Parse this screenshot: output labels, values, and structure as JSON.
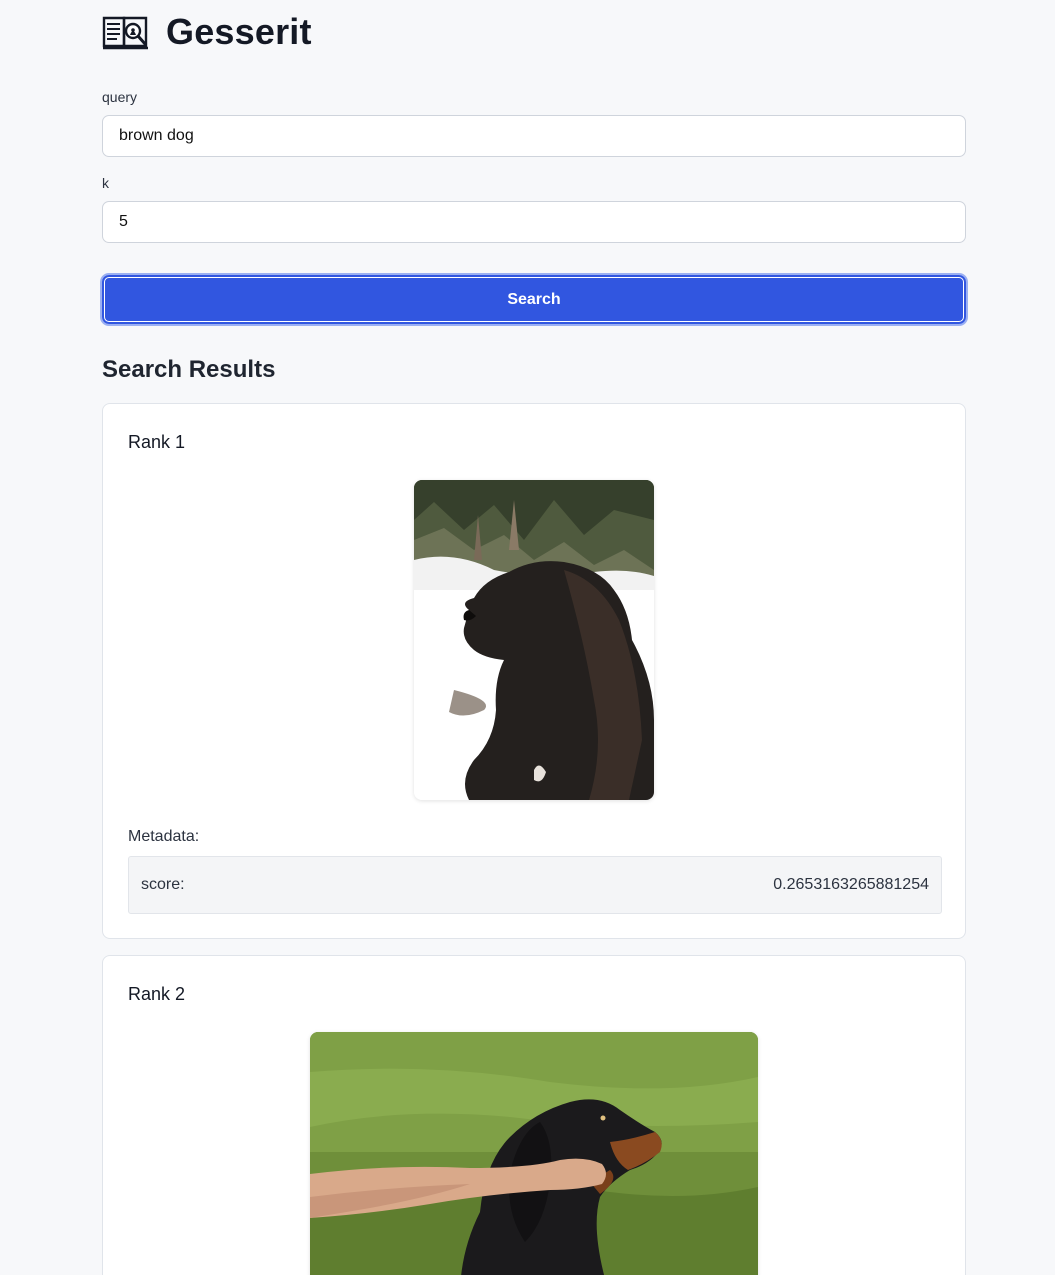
{
  "app": {
    "title": "Gesserit",
    "logo_icon": "book-search-icon"
  },
  "form": {
    "query_label": "query",
    "query_value": "brown dog",
    "k_label": "k",
    "k_value": "5",
    "search_label": "Search",
    "accent_color": "#3156e0"
  },
  "results": {
    "heading": "Search Results",
    "items": [
      {
        "rank_label": "Rank 1",
        "image_subject": "black-dog-in-snow-photo",
        "metadata_label": "Metadata:",
        "metadata": [
          {
            "key": "score:",
            "value": "0.2653163265881254"
          }
        ]
      },
      {
        "rank_label": "Rank 2",
        "image_subject": "black-and-tan-dog-on-grass-photo"
      }
    ]
  }
}
